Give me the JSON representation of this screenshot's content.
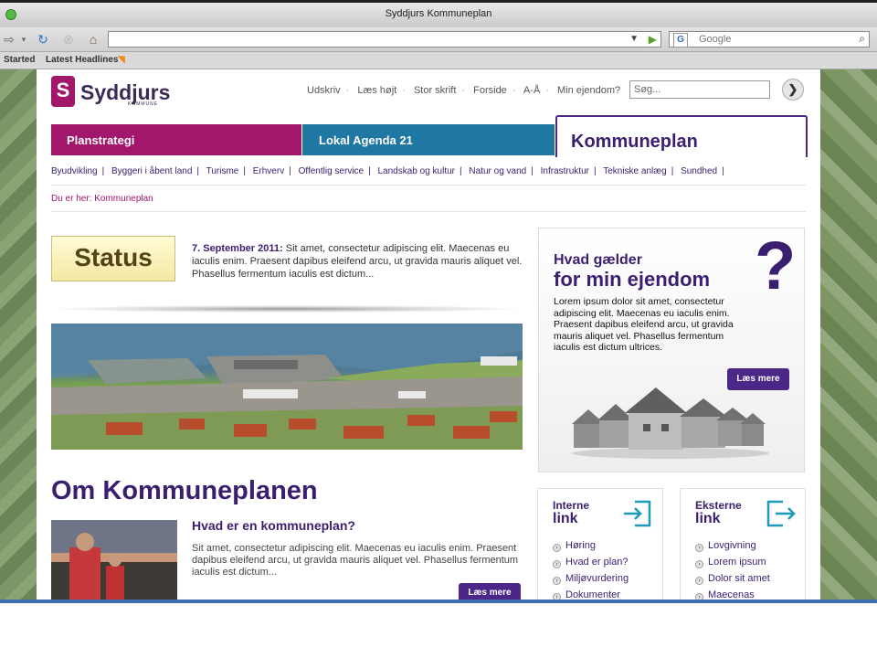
{
  "browser": {
    "window_title": "Syddjurs Kommuneplan",
    "search_placeholder": "Google",
    "bookmarks": [
      {
        "label": "Started"
      },
      {
        "label": "Latest Headlines"
      }
    ]
  },
  "header": {
    "logo_name": "Syddjurs",
    "logo_sub": "KOMMUNE",
    "util_links": [
      "Udskriv",
      "Læs højt",
      "Stor skrift",
      "Forside",
      "A-Å",
      "Min ejendom?"
    ],
    "search_placeholder": "Søg..."
  },
  "tabs": [
    {
      "label": "Planstrategi",
      "color": "#a2166b"
    },
    {
      "label": "Lokal Agenda 21",
      "color": "#1f77a3"
    },
    {
      "label": "Kommuneplan",
      "color": "#3b1f6f",
      "active": true
    }
  ],
  "subnav": [
    "Byudvikling",
    "Byggeri i åbent land",
    "Turisme",
    "Erhverv",
    "Offentlig service",
    "Landskab og kultur",
    "Natur og vand",
    "Infrastruktur",
    "Tekniske anlæg",
    "Sundhed"
  ],
  "breadcrumb": "Du er her: Kommuneplan",
  "status": {
    "badge": "Status",
    "date": "7. September 2011:",
    "text": "Sit amet, consectetur adipiscing elit. Maecenas eu iaculis enim. Praesent dapibus eleifend arcu, ut gravida mauris aliquet vel. Phasellus fermentum iaculis est dictum..."
  },
  "promo": {
    "title_line1": "Hvad gælder",
    "title_line2": "for min ejendom",
    "question_mark": "?",
    "text": "Lorem ipsum dolor sit amet, consectetur adipiscing elit. Maecenas eu iaculis enim. Praesent dapibus eleifend arcu, ut gravida mauris aliquet vel. Phasellus fermentum iaculis est dictum ultrices.",
    "button": "Læs mere"
  },
  "om": {
    "title": "Om Kommuneplanen",
    "subtitle": "Hvad er en kommuneplan?",
    "text": "Sit amet, consectetur adipiscing elit. Maecenas eu iaculis enim. Praesent dapibus eleifend arcu, ut gravida mauris aliquet vel. Phasellus fermentum iaculis est dictum...",
    "button": "Læs mere"
  },
  "interne": {
    "title1": "Interne",
    "title2": "link",
    "items": [
      "Høring",
      "Hvad er plan?",
      "Miljøvurdering",
      "Dokumenter"
    ]
  },
  "eksterne": {
    "title1": "Eksterne",
    "title2": "link",
    "items": [
      "Lovgivning",
      "Lorem ipsum",
      "Dolor sit amet",
      "Maecenas"
    ]
  },
  "colors": {
    "brand_purple": "#3b1f6f",
    "brand_magenta": "#a2166b",
    "brand_blue": "#1f77a3"
  }
}
